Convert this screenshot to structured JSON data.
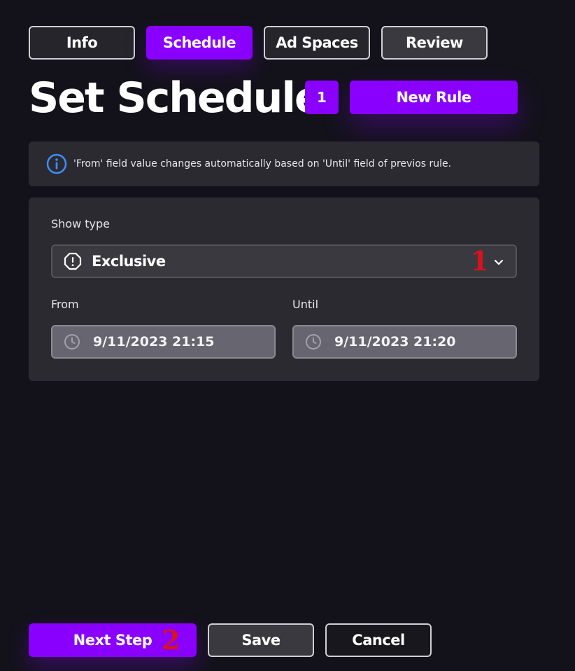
{
  "tabs": [
    {
      "label": "Info"
    },
    {
      "label": "Schedule"
    },
    {
      "label": "Ad Spaces"
    },
    {
      "label": "Review"
    }
  ],
  "header": {
    "title": "Set Schedule",
    "rule_count": "1",
    "new_rule_label": "New Rule"
  },
  "info": {
    "icon": "info-icon",
    "text": "'From' field value changes automatically based on 'Until' field of previos rule."
  },
  "rule": {
    "show_type_label": "Show type",
    "show_type_value": "Exclusive",
    "show_type_icon": "exclamation-octagon-icon",
    "from_label": "From",
    "from_value": "9/11/2023 21:15",
    "until_label": "Until",
    "until_value": "9/11/2023 21:20"
  },
  "annotations": {
    "marker_1": "1",
    "marker_2": "2"
  },
  "footer": {
    "next_label": "Next Step",
    "save_label": "Save",
    "cancel_label": "Cancel"
  },
  "colors": {
    "background": "#13121a",
    "accent": "#8a00ff",
    "panel": "#2b2a31",
    "info_blue": "#3f8cff",
    "annotation_red": "#d6131e"
  }
}
